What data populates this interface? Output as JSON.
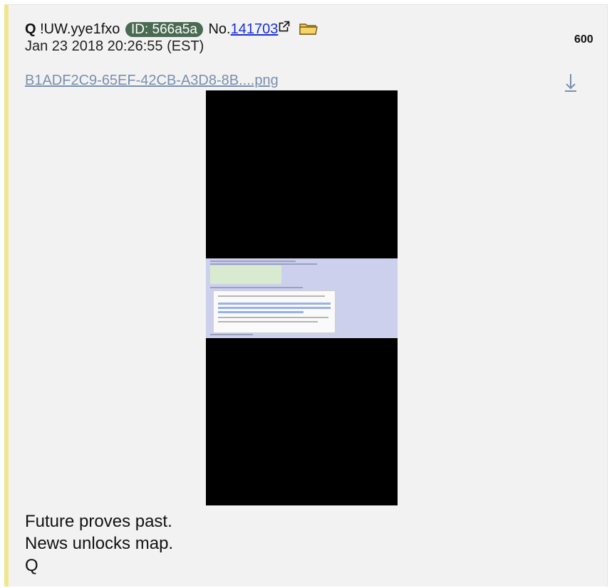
{
  "post": {
    "author": "Q",
    "tripcode": "!UW.yye1fxo",
    "id_label": "ID: 566a5a",
    "number_prefix": "No.",
    "number": "141703",
    "date": "Jan 23 2018 20:26:55 (EST)",
    "reply_count": "600",
    "file_name": "B1ADF2C9-65EF-42CB-A3D8-8B....png",
    "message_lines": [
      "Future proves past.",
      "News unlocks map.",
      "Q"
    ]
  },
  "colors": {
    "border_accent": "#f0e68c",
    "id_badge_bg": "#4a6a52",
    "link": "#1a2fd6",
    "file_link": "#7a8fae"
  },
  "icons": {
    "external_link": "external-link-icon",
    "folder": "folder-icon",
    "download": "download-icon"
  }
}
